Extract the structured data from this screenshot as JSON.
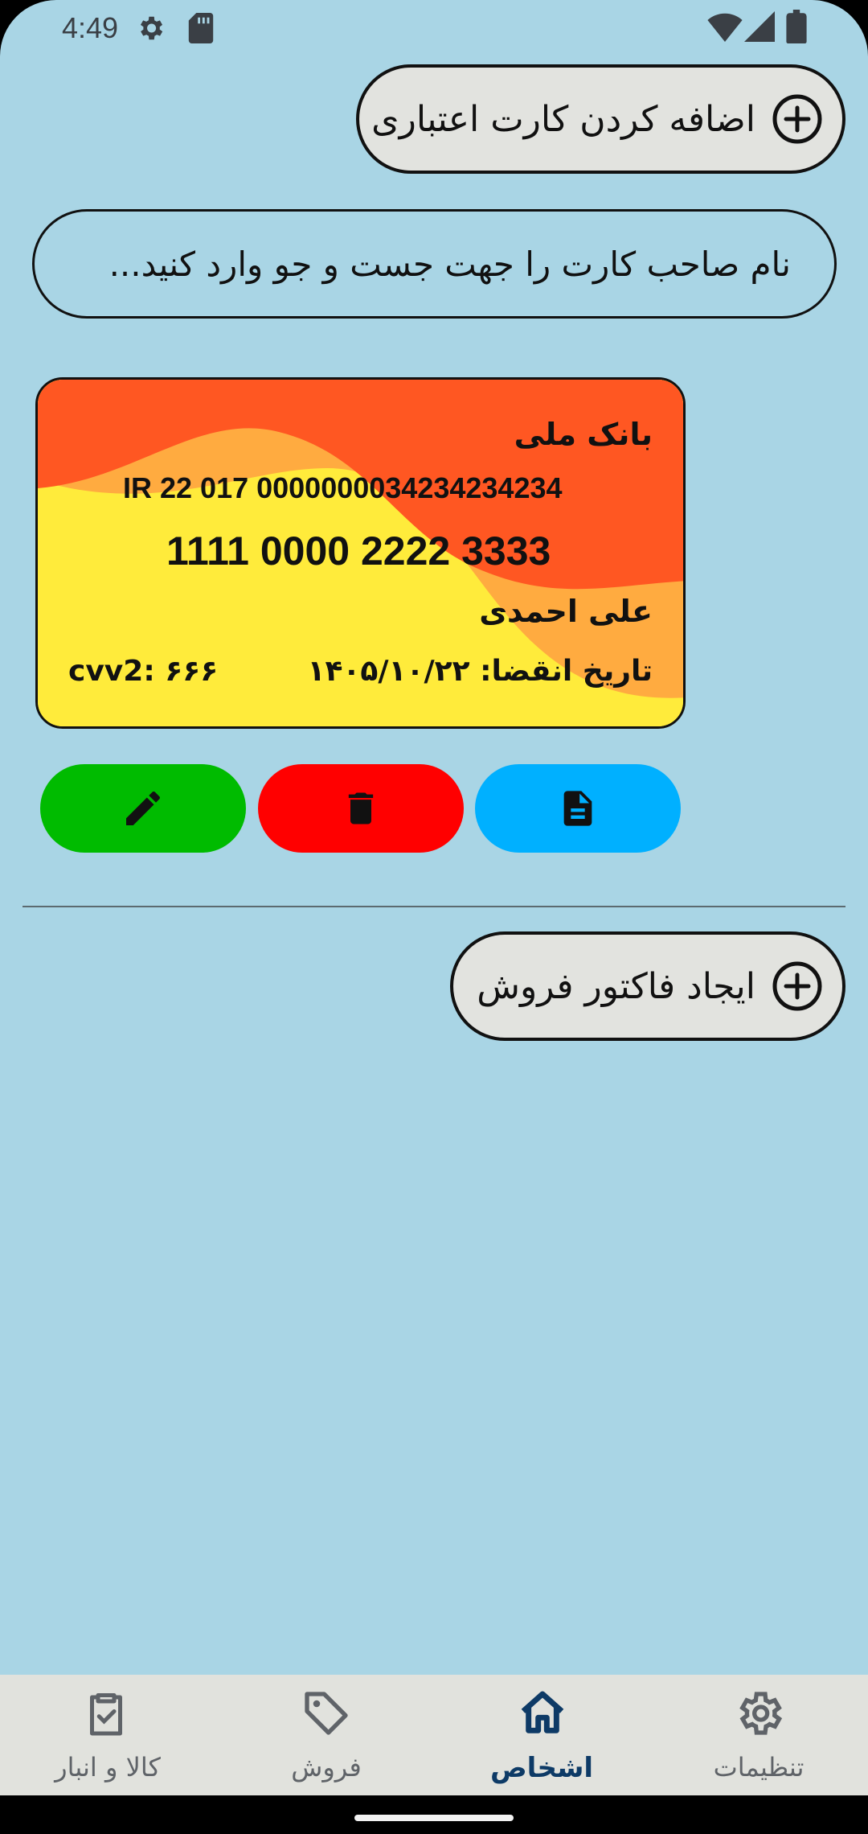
{
  "status_bar": {
    "time": "4:49",
    "icons": [
      "settings-icon",
      "sd-card-icon",
      "wifi-icon",
      "signal-icon",
      "battery-icon"
    ]
  },
  "header": {
    "add_card_label": "اضافه کردن کارت اعتباری"
  },
  "search": {
    "placeholder": "نام صاحب کارت را جهت جست و جو وارد کنید..."
  },
  "card": {
    "bank_name": "بانک ملی",
    "iban": "IR 22 017 0000000034234234234",
    "number": "1111 0000 2222 3333",
    "holder": "علی احمدی",
    "expiry": "تاریخ انقضا: ۱۴۰۵/۱۰/۲۲",
    "cvv": "cvv2: ۶۶۶",
    "colors": {
      "top": "#ff5722",
      "middle": "#ffab40",
      "bottom": "#ffeb3b"
    }
  },
  "actions": [
    {
      "name": "edit",
      "icon": "pencil-icon",
      "color": "#00bb00"
    },
    {
      "name": "delete",
      "icon": "trash-icon",
      "color": "#ff0000"
    },
    {
      "name": "details",
      "icon": "document-icon",
      "color": "#00b0ff"
    }
  ],
  "invoice": {
    "label": "ایجاد فاکتور فروش"
  },
  "bottom_nav": {
    "items": [
      {
        "label": "تنظیمات",
        "icon": "gear-icon",
        "active": false
      },
      {
        "label": "اشخاص",
        "icon": "home-icon",
        "active": true
      },
      {
        "label": "فروش",
        "icon": "tag-icon",
        "active": false
      },
      {
        "label": "کالا و انبار",
        "icon": "clipboard-check-icon",
        "active": false
      }
    ]
  },
  "colors": {
    "background": "#a9d5e5",
    "active_nav": "#0d3a66",
    "pill_bg": "#e2e3df"
  }
}
